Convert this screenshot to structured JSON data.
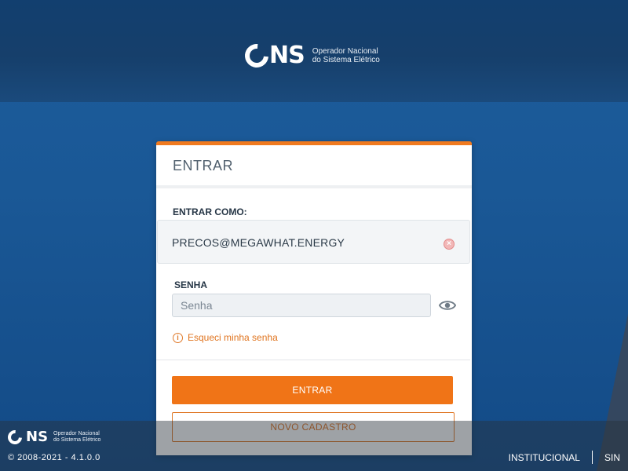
{
  "brand": {
    "logo_mark": "NS",
    "org_line1": "Operador Nacional",
    "org_line2": "do Sistema Elétrico"
  },
  "login_card": {
    "title": "ENTRAR",
    "entrar_como_label": "ENTRAR COMO:",
    "account_value": "PRECOS@MEGAWHAT.ENERGY",
    "senha_label": "SENHA",
    "senha_placeholder": "Senha",
    "senha_value": "",
    "forgot_password": "Esqueci minha senha",
    "submit_label": "ENTRAR",
    "register_label": "NOVO CADASTRO"
  },
  "footer": {
    "copyright": "© 2008-2021 - 4.1.0.0",
    "links": [
      "INSTITUCIONAL",
      "SIN"
    ]
  },
  "icons": {
    "clear": "clear-circle-icon",
    "show_password": "eye-icon",
    "info": "info-circle-icon"
  },
  "colors": {
    "accent": "#f07417",
    "background": "#1a5896",
    "header_band": "#163f6b"
  }
}
